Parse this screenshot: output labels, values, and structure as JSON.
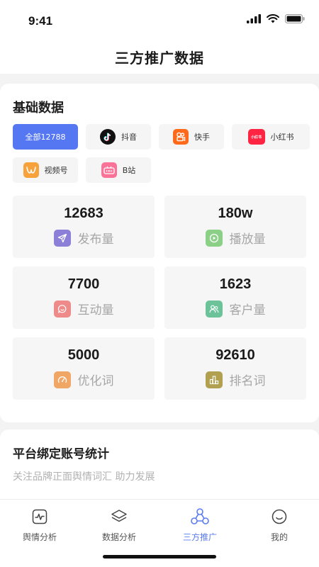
{
  "status": {
    "time": "9:41"
  },
  "nav": {
    "title": "三方推广数据"
  },
  "basic": {
    "title": "基础数据",
    "chips": [
      {
        "label": "全部12788",
        "icon": "none",
        "active": true
      },
      {
        "label": "抖音",
        "icon": "douyin-icon"
      },
      {
        "label": "快手",
        "icon": "kuaishou-icon"
      },
      {
        "label": "小红书",
        "icon": "xiaohongshu-icon",
        "icon_text": "小红书"
      },
      {
        "label": "视频号",
        "icon": "shipinhao-icon"
      },
      {
        "label": "B站",
        "icon": "bilibili-icon"
      }
    ],
    "stats": [
      {
        "value": "12683",
        "label": "发布量",
        "icon": "send-icon",
        "color": "#8b7fd8"
      },
      {
        "value": "180w",
        "label": "播放量",
        "icon": "play-icon",
        "color": "#8ccf86"
      },
      {
        "value": "7700",
        "label": "互动量",
        "icon": "chat-icon",
        "color": "#ee8a8a"
      },
      {
        "value": "1623",
        "label": "客户量",
        "icon": "users-icon",
        "color": "#6cc39a"
      },
      {
        "value": "5000",
        "label": "优化词",
        "icon": "gauge-icon",
        "color": "#f0a766"
      },
      {
        "value": "92610",
        "label": "排名词",
        "icon": "ranking-icon",
        "color": "#b0a050"
      }
    ]
  },
  "platform": {
    "title": "平台绑定账号统计",
    "subtitle": "关注品牌正面舆情词汇 助力发展"
  },
  "tabs": [
    {
      "label": "舆情分析",
      "icon": "pulse-icon"
    },
    {
      "label": "数据分析",
      "icon": "layers-icon"
    },
    {
      "label": "三方推广",
      "icon": "network-icon",
      "active": true
    },
    {
      "label": "我的",
      "icon": "smile-icon"
    }
  ],
  "colors": {
    "accent": "#5577f2",
    "tab_active": "#5b7cf0"
  }
}
